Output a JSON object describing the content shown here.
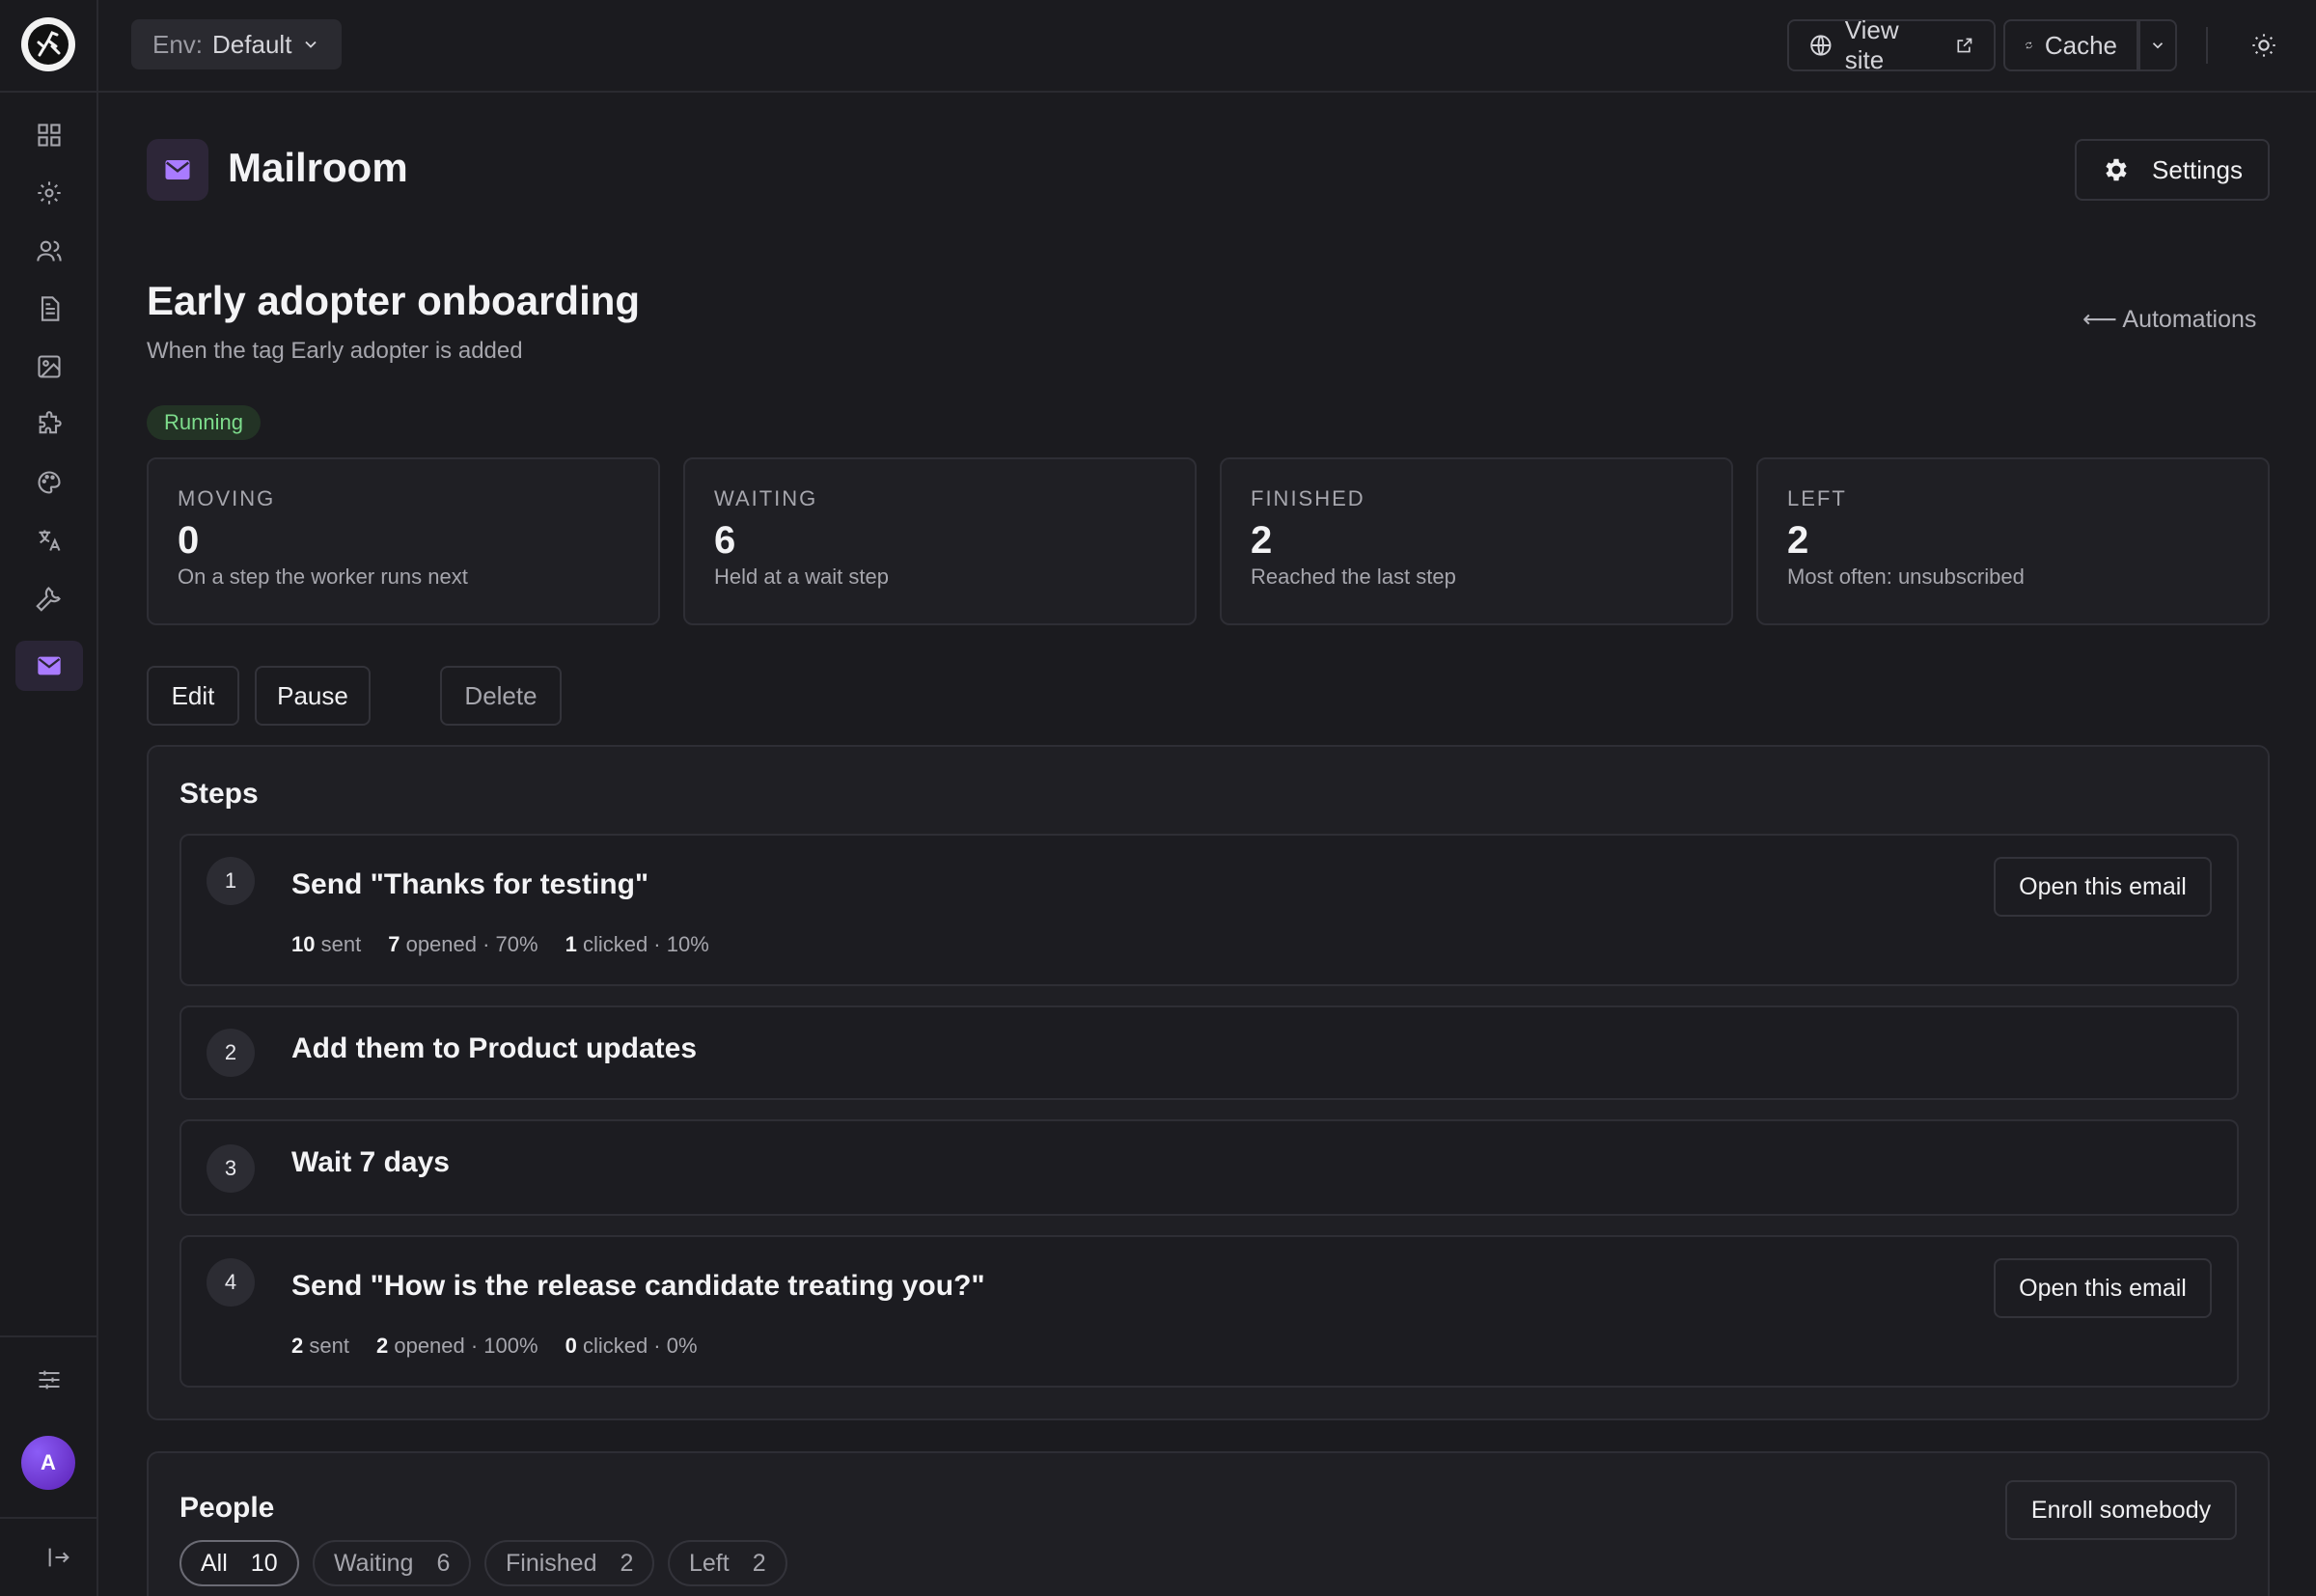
{
  "topbar": {
    "env_label": "Env:",
    "env_value": "Default",
    "view_site": "View site",
    "cache": "Cache"
  },
  "sidebar": {
    "items": [
      {
        "icon": "dashboard-icon"
      },
      {
        "icon": "gear-icon"
      },
      {
        "icon": "users-icon"
      },
      {
        "icon": "document-icon"
      },
      {
        "icon": "image-icon"
      },
      {
        "icon": "puzzle-icon"
      },
      {
        "icon": "palette-icon"
      },
      {
        "icon": "translate-icon"
      },
      {
        "icon": "wrench-icon"
      },
      {
        "icon": "mail-icon",
        "active": true
      }
    ],
    "avatar_initial": "A"
  },
  "header": {
    "app_title": "Mailroom",
    "settings": "Settings"
  },
  "automation": {
    "title": "Early adopter onboarding",
    "subtitle": "When the tag Early adopter is added",
    "back_link": "⟵ Automations",
    "status": "Running"
  },
  "stats": [
    {
      "label": "MOVING",
      "value": "0",
      "desc": "On a step the worker runs next"
    },
    {
      "label": "WAITING",
      "value": "6",
      "desc": "Held at a wait step"
    },
    {
      "label": "FINISHED",
      "value": "2",
      "desc": "Reached the last step"
    },
    {
      "label": "LEFT",
      "value": "2",
      "desc": "Most often: unsubscribed"
    }
  ],
  "actions": {
    "edit": "Edit",
    "pause": "Pause",
    "delete": "Delete"
  },
  "steps": {
    "title": "Steps",
    "items": [
      {
        "num": "1",
        "title": "Send \"Thanks for testing\"",
        "button": "Open this email",
        "stats": {
          "sent": "10",
          "sent_label": "sent",
          "opened": "7",
          "opened_label": "opened · 70%",
          "clicked": "1",
          "clicked_label": "clicked · 10%"
        }
      },
      {
        "num": "2",
        "title": "Add them to Product updates"
      },
      {
        "num": "3",
        "title": "Wait 7 days"
      },
      {
        "num": "4",
        "title": "Send \"How is the release candidate treating you?\"",
        "button": "Open this email",
        "stats": {
          "sent": "2",
          "sent_label": "sent",
          "opened": "2",
          "opened_label": "opened · 100%",
          "clicked": "0",
          "clicked_label": "clicked · 0%"
        }
      }
    ]
  },
  "people": {
    "title": "People",
    "enroll": "Enroll somebody",
    "filters": [
      {
        "label": "All",
        "count": "10",
        "active": true
      },
      {
        "label": "Waiting",
        "count": "6"
      },
      {
        "label": "Finished",
        "count": "2"
      },
      {
        "label": "Left",
        "count": "2"
      }
    ]
  },
  "colors": {
    "accent": "#a97bff",
    "success": "#7ddc8c",
    "background": "#1b1b1f"
  }
}
